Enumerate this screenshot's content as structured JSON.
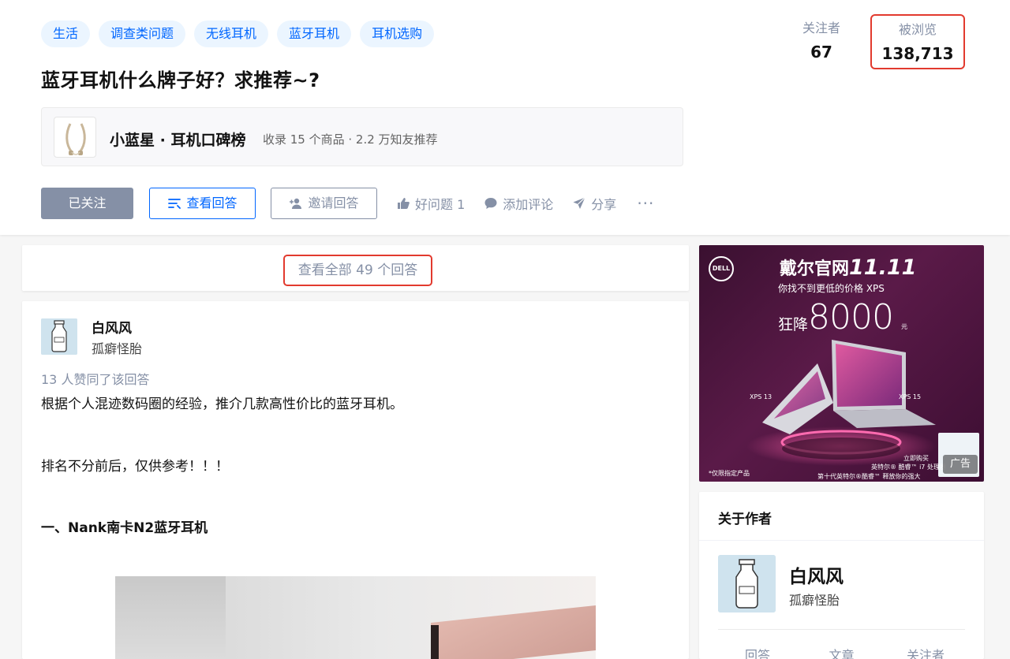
{
  "header": {
    "topics": [
      "生活",
      "调查类问题",
      "无线耳机",
      "蓝牙耳机",
      "耳机选购"
    ],
    "title": "蓝牙耳机什么牌子好？求推荐~?",
    "stats": {
      "followers_label": "关注者",
      "followers_value": "67",
      "views_label": "被浏览",
      "views_value": "138,713"
    },
    "rank_card": {
      "title": "小蓝星 · 耳机口碑榜",
      "meta": "收录 15 个商品 · 2.2 万知友推荐"
    },
    "actions": {
      "followed": "已关注",
      "view_answers": "查看回答",
      "invite": "邀请回答",
      "good_question": "好问题 1",
      "comment": "添加评论",
      "share": "分享",
      "more": "···"
    }
  },
  "main": {
    "view_all": "查看全部 49 个回答",
    "answer": {
      "author_name": "白风风",
      "author_bio": "孤癖怪胎",
      "vote_summary": "13 人赞同了该回答",
      "paragraph1": "根据个人混迹数码圈的经验，推介几款高性价比的蓝牙耳机。",
      "paragraph2": "排名不分前后，仅供参考！！！",
      "heading1": "一、Nank南卡N2蓝牙耳机"
    }
  },
  "sidebar": {
    "ad": {
      "logo": "DELL",
      "headline": "戴尔官网",
      "headline_num": "11.11",
      "sub": "你找不到更低的价格 XPS",
      "price_label": "狂降",
      "price": "8000",
      "price_unit": "元",
      "model_a": "XPS 13",
      "model_b": "XPS 15",
      "buy": "立即购买",
      "cpu": "英特尔® 酷睿™ i7 处理器",
      "cpu2": "第十代英特尔®酷睿™ 释放你的强大",
      "note": "*仅限指定产品",
      "badge": "广告"
    },
    "about": {
      "title": "关于作者",
      "name": "白风风",
      "bio": "孤癖怪胎",
      "stats": [
        "回答",
        "文章",
        "关注者"
      ]
    }
  },
  "colors": {
    "accent": "#0066ff",
    "muted": "#8590a6",
    "highlight_border": "#e23a2e",
    "topic_bg": "#ebf5ff"
  },
  "icons": {
    "view_answers": "list-icon",
    "invite": "add-user-icon",
    "good_question": "thumbs-up-icon",
    "comment": "comment-bubble-icon",
    "share": "paper-plane-icon",
    "more": "more-dots-icon"
  }
}
